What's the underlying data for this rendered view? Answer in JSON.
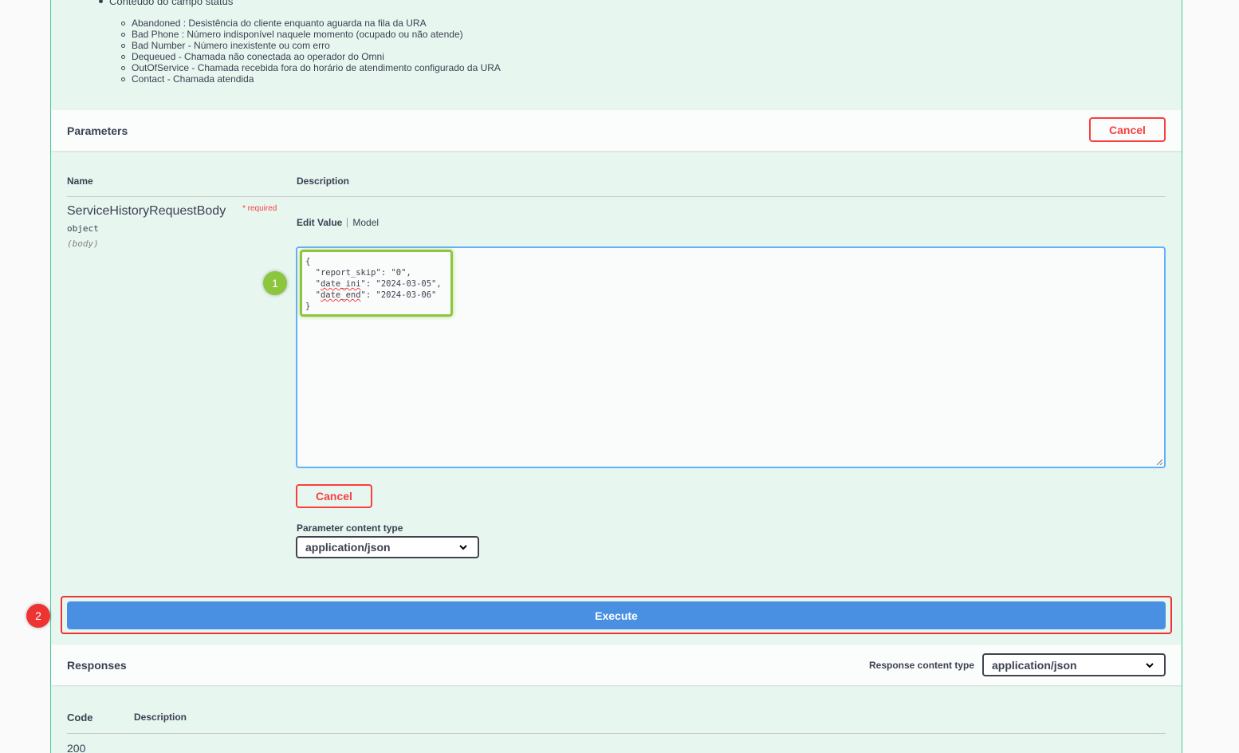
{
  "status_block": {
    "heading": "Conteúdo do campo status",
    "items": [
      "Abandoned : Desistência do cliente enquanto aguarda na fila da URA",
      "Bad Phone : Número indisponível naquele momento (ocupado ou não atende)",
      "Bad Number - Número inexistente ou com erro",
      "Dequeued - Chamada não conectada ao operador do Omni",
      "OutOfService - Chamada recebida fora do horário de atendimento configurado da URA",
      "Contact - Chamada atendida"
    ]
  },
  "parameters": {
    "title": "Parameters",
    "cancel_label": "Cancel",
    "col_name": "Name",
    "col_description": "Description",
    "param_name": "ServiceHistoryRequestBody",
    "required_label": "* required",
    "param_type": "object",
    "param_in": "(body)",
    "tab_edit": "Edit Value",
    "tab_model": "Model",
    "code_open": "{",
    "code_line1": "  \"report_skip\": \"0\",",
    "code_line2_pre": "  \"",
    "code_line2_key": "date_ini",
    "code_line2_post": "\": \"2024-03-05\",",
    "code_line3_pre": "  \"",
    "code_line3_key": "date_end",
    "code_line3_post": "\": \"2024-03-06\"",
    "code_close": "}",
    "cancel_bottom_label": "Cancel",
    "content_type_label": "Parameter content type",
    "content_type_value": "application/json"
  },
  "annotations": {
    "marker_1": "1",
    "marker_2": "2"
  },
  "execute_label": "Execute",
  "responses": {
    "title": "Responses",
    "content_type_label": "Response content type",
    "content_type_value": "application/json",
    "col_code": "Code",
    "col_description": "Description",
    "first_code": "200"
  },
  "colors": {
    "accent_green": "#49cc90",
    "cancel_red": "#f93e3e",
    "execute_blue": "#4990e2",
    "highlight_green": "#8cc63f",
    "highlight_red": "#e33333"
  }
}
